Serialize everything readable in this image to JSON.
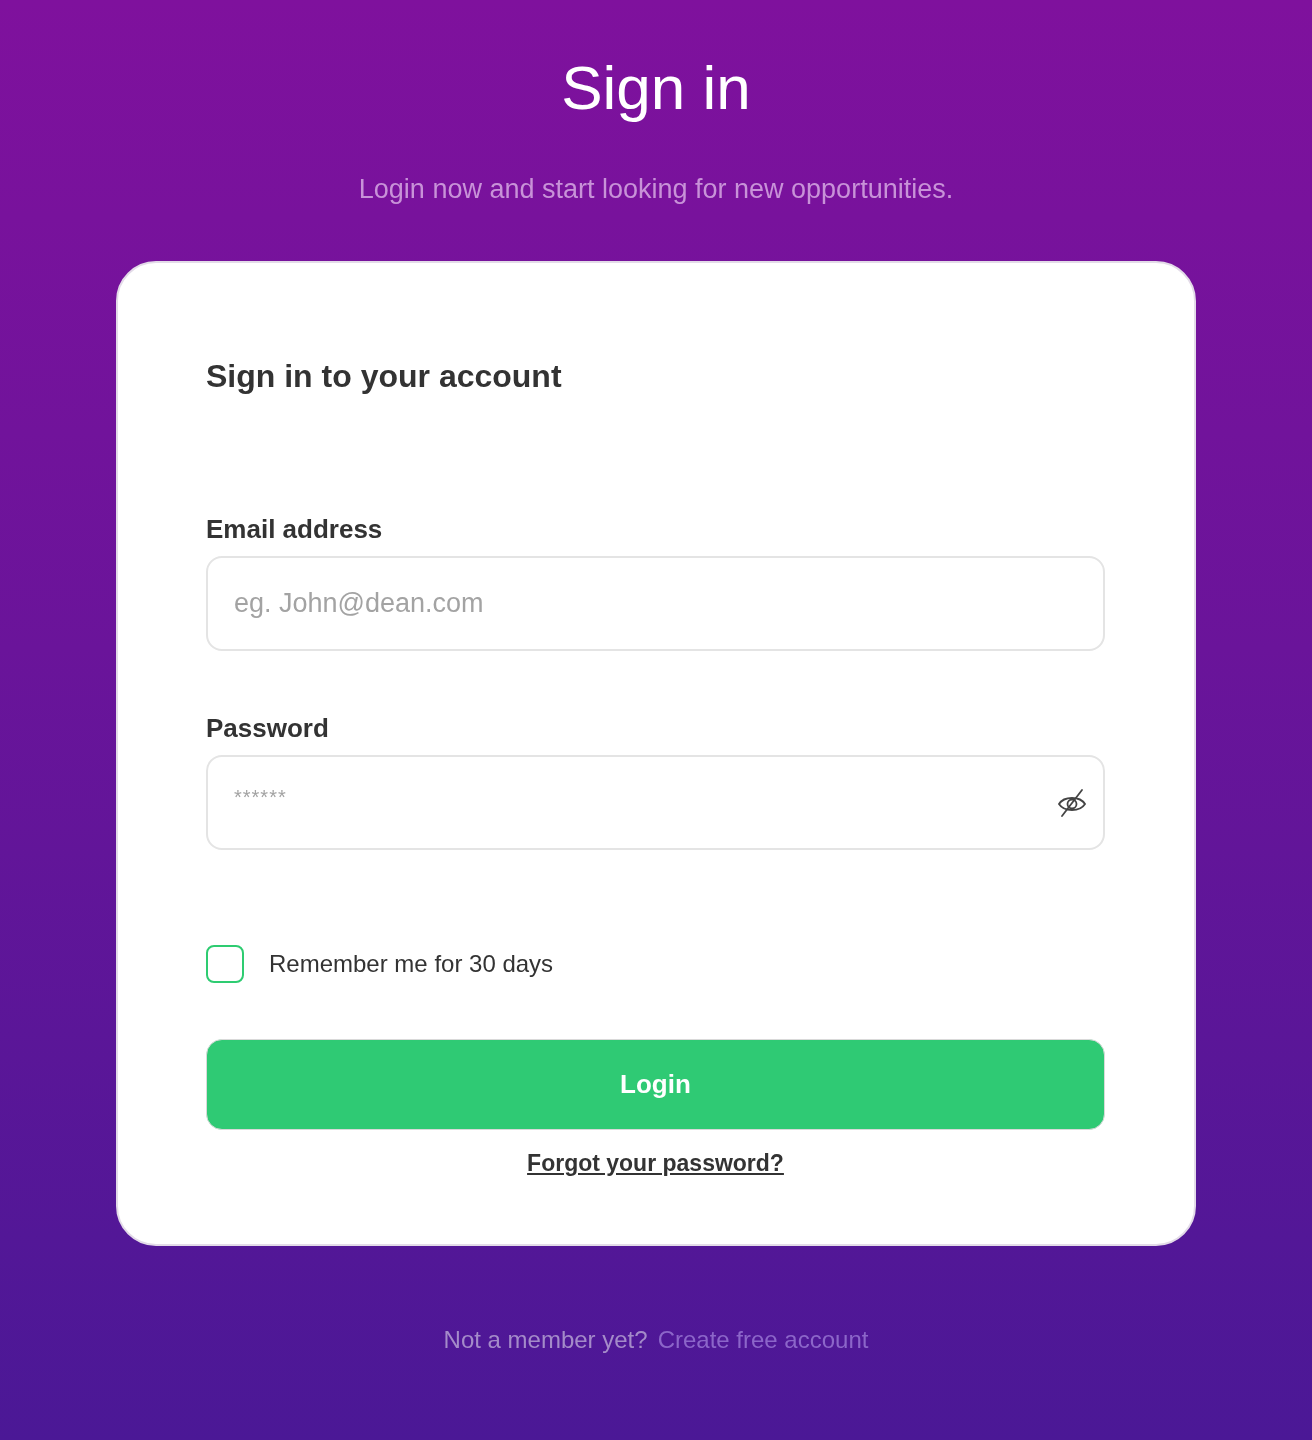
{
  "header": {
    "title": "Sign in",
    "subtitle": "Login now and start looking for new opportunities."
  },
  "card": {
    "heading": "Sign in to your account",
    "fields": [
      {
        "kind": "email",
        "label": "Email address",
        "placeholder": "eg. John@dean.com"
      },
      {
        "kind": "password",
        "label": "Password",
        "placeholder": "******"
      }
    ],
    "remember": {
      "label": "Remember me for 30 days",
      "checked": false
    },
    "login_button": "Login",
    "forgot_link": "Forgot your password?"
  },
  "footer": {
    "text": "Not a member yet?",
    "link": "Create free account"
  }
}
